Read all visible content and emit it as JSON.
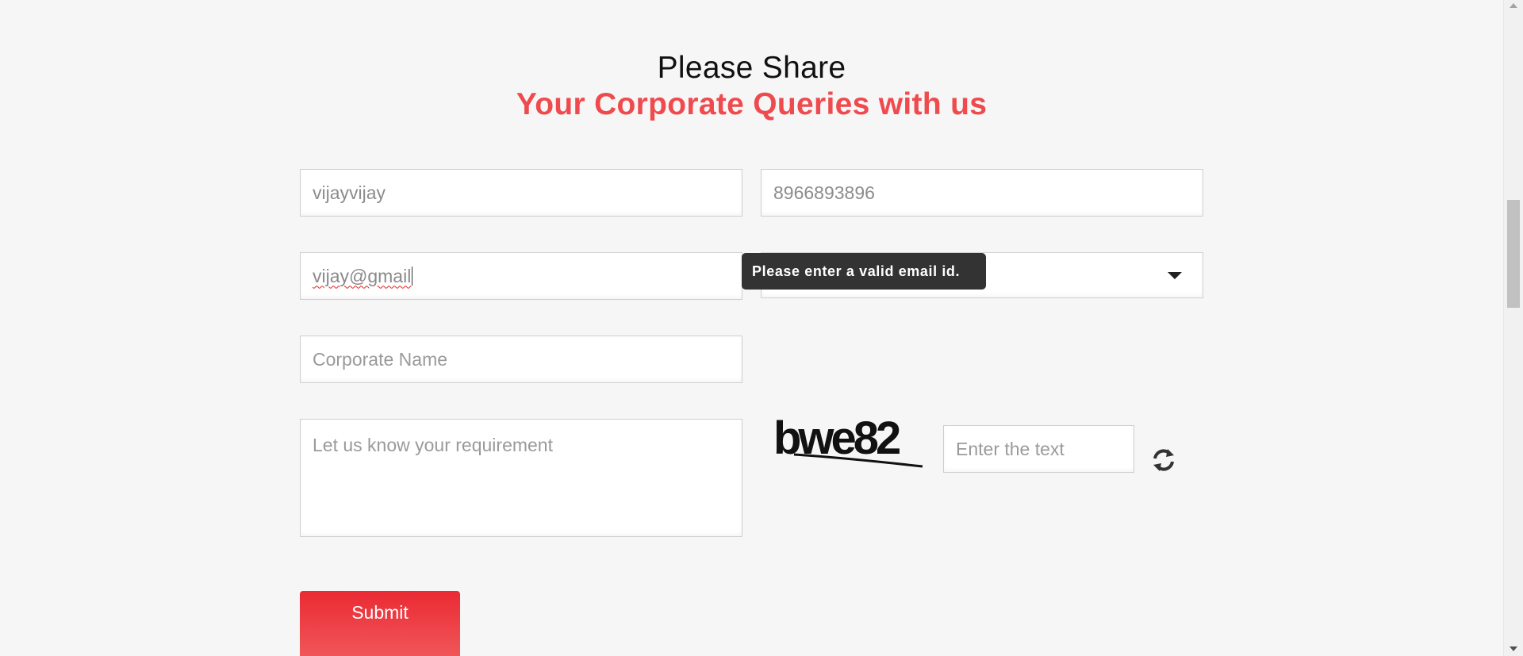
{
  "heading": {
    "line1": "Please Share",
    "line2": "Your Corporate Queries with us"
  },
  "form": {
    "name_value": "vijayvijay",
    "phone_value": "8966893896",
    "email_value": "vijay@gmail",
    "select_value": "",
    "corporate_name_placeholder": "Corporate Name",
    "requirement_placeholder": "Let us know your requirement",
    "captcha_text": "bwe82",
    "captcha_input_placeholder": "Enter the text",
    "submit_label": "Submit"
  },
  "tooltip": {
    "message": "Please enter a valid email id."
  },
  "colors": {
    "accent": "#ef4a4d",
    "button": "#ea2a33",
    "tooltip_bg": "#333333"
  },
  "icons": {
    "refresh": "refresh-icon",
    "dropdown": "chevron-down-icon"
  }
}
